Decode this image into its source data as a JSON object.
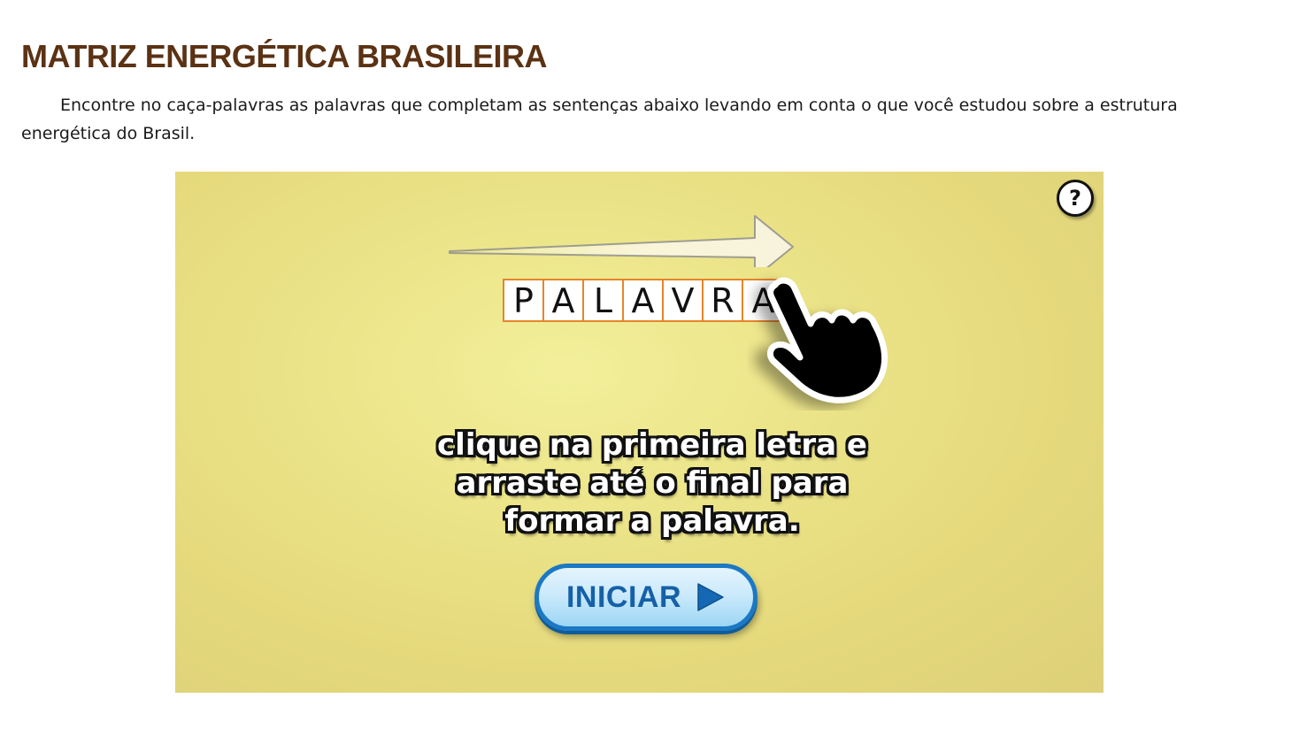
{
  "page": {
    "title": "MATRIZ ENERGÉTICA BRASILEIRA",
    "instructions": "Encontre no caça-palavras as palavras que completam as sentenças abaixo levando em conta o que você estudou sobre a estrutura energética do Brasil."
  },
  "game": {
    "help_label": "?",
    "demo_letters": [
      "P",
      "A",
      "L",
      "A",
      "V",
      "R",
      "A"
    ],
    "instruction_lines": [
      "clique na primeira letra e",
      "arraste até o final para",
      "formar a palavra."
    ],
    "start_label": "INICIAR",
    "icons": {
      "help": "question-mark-icon",
      "arrow": "drag-direction-arrow-icon",
      "hand": "pointing-hand-icon",
      "play": "play-triangle-icon"
    },
    "colors": {
      "background": "#e9e083",
      "title": "#5b3214",
      "letter_border": "#e5852a",
      "button_border": "#1b78c4",
      "button_text": "#1560a8"
    }
  }
}
